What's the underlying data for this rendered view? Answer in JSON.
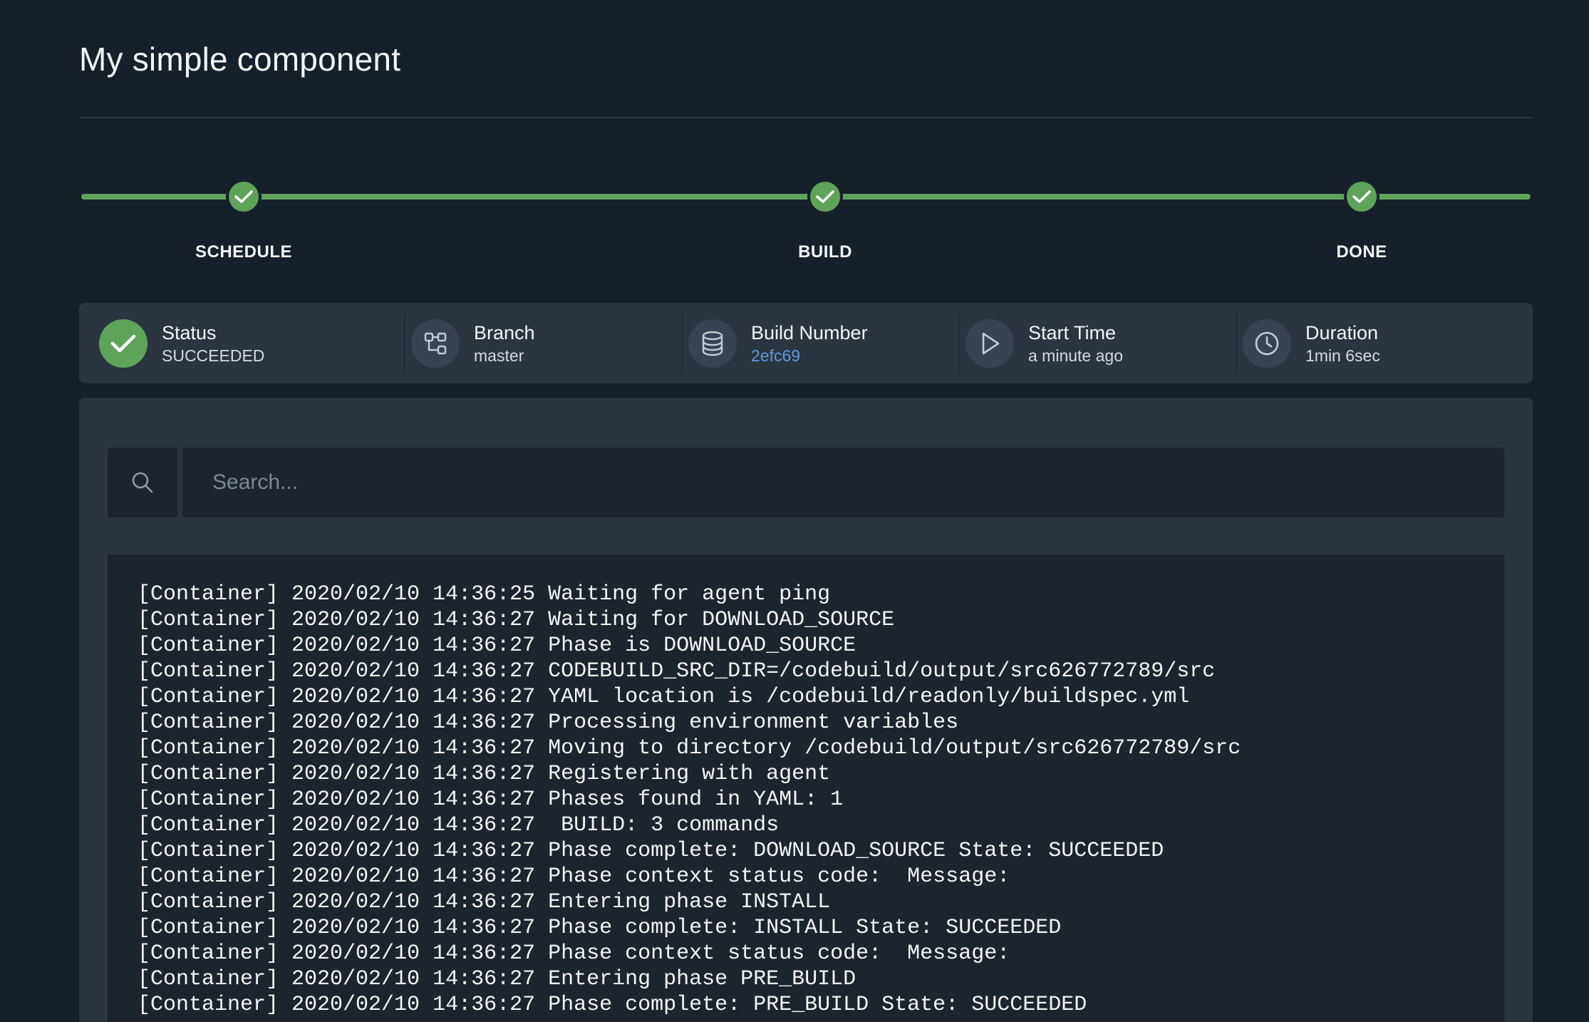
{
  "page": {
    "title": "My simple component"
  },
  "stepper": {
    "steps": [
      {
        "label": "SCHEDULE",
        "state": "complete"
      },
      {
        "label": "BUILD",
        "state": "complete"
      },
      {
        "label": "DONE",
        "state": "complete"
      }
    ],
    "color": "#5fa35a"
  },
  "info": {
    "status": {
      "label": "Status",
      "value": "SUCCEEDED",
      "icon": "check-circle-icon"
    },
    "branch": {
      "label": "Branch",
      "value": "master",
      "icon": "branch-icon"
    },
    "build_number": {
      "label": "Build Number",
      "value": "2efc69",
      "icon": "database-icon"
    },
    "start_time": {
      "label": "Start Time",
      "value": "a minute ago",
      "icon": "play-icon"
    },
    "duration": {
      "label": "Duration",
      "value": "1min 6sec",
      "icon": "clock-icon"
    }
  },
  "search": {
    "placeholder": "Search...",
    "value": ""
  },
  "log": {
    "lines": [
      "[Container] 2020/02/10 14:36:25 Waiting for agent ping",
      "[Container] 2020/02/10 14:36:27 Waiting for DOWNLOAD_SOURCE",
      "[Container] 2020/02/10 14:36:27 Phase is DOWNLOAD_SOURCE",
      "[Container] 2020/02/10 14:36:27 CODEBUILD_SRC_DIR=/codebuild/output/src626772789/src",
      "[Container] 2020/02/10 14:36:27 YAML location is /codebuild/readonly/buildspec.yml",
      "[Container] 2020/02/10 14:36:27 Processing environment variables",
      "[Container] 2020/02/10 14:36:27 Moving to directory /codebuild/output/src626772789/src",
      "[Container] 2020/02/10 14:36:27 Registering with agent",
      "[Container] 2020/02/10 14:36:27 Phases found in YAML: 1",
      "[Container] 2020/02/10 14:36:27  BUILD: 3 commands",
      "[Container] 2020/02/10 14:36:27 Phase complete: DOWNLOAD_SOURCE State: SUCCEEDED",
      "[Container] 2020/02/10 14:36:27 Phase context status code:  Message:",
      "[Container] 2020/02/10 14:36:27 Entering phase INSTALL",
      "[Container] 2020/02/10 14:36:27 Phase complete: INSTALL State: SUCCEEDED",
      "[Container] 2020/02/10 14:36:27 Phase context status code:  Message:",
      "[Container] 2020/02/10 14:36:27 Entering phase PRE_BUILD",
      "[Container] 2020/02/10 14:36:27 Phase complete: PRE_BUILD State: SUCCEEDED"
    ]
  },
  "colors": {
    "background": "#16202a",
    "panel": "#2b3540",
    "success": "#5fa35a",
    "link": "#5a9ae0"
  }
}
